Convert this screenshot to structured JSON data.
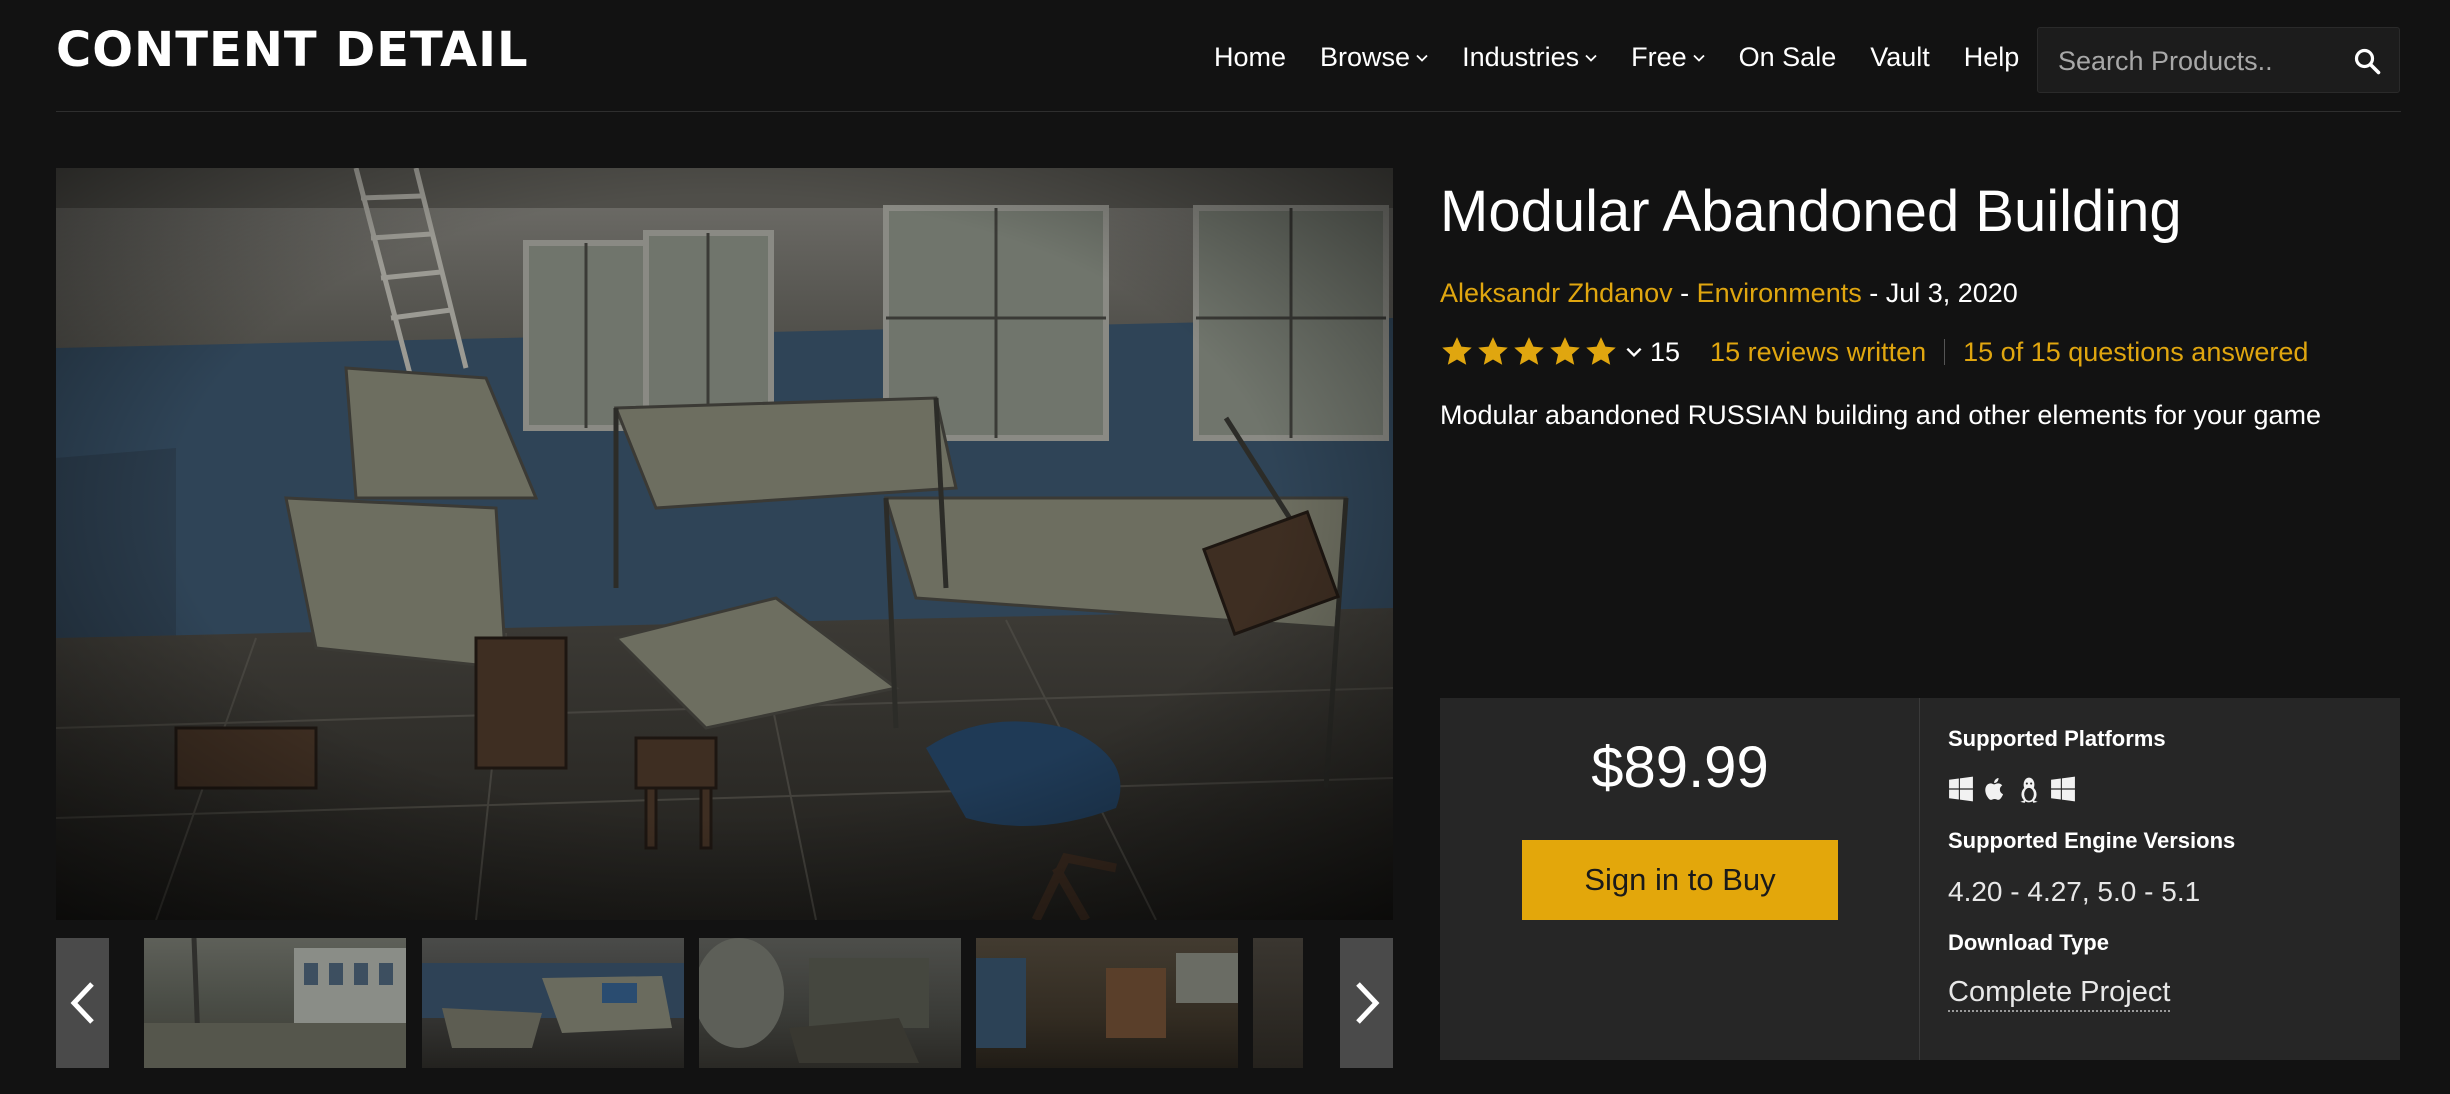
{
  "header": {
    "site_title": "CONTENT DETAIL",
    "nav": [
      {
        "label": "Home",
        "has_dropdown": false
      },
      {
        "label": "Browse",
        "has_dropdown": true
      },
      {
        "label": "Industries",
        "has_dropdown": true
      },
      {
        "label": "Free",
        "has_dropdown": true
      },
      {
        "label": "On Sale",
        "has_dropdown": false
      },
      {
        "label": "Vault",
        "has_dropdown": false
      },
      {
        "label": "Help",
        "has_dropdown": false
      }
    ],
    "search": {
      "placeholder": "Search Products..",
      "icon": "search-icon"
    }
  },
  "product": {
    "title": "Modular Abandoned Building",
    "author": "Aleksandr Zhdanov",
    "category": "Environments",
    "date": "Jul 3, 2020",
    "meta_separator": " - ",
    "rating": {
      "stars": 5,
      "max_stars": 5,
      "count": "15"
    },
    "reviews_link": "15 reviews written",
    "questions_link": "15 of 15 questions answered",
    "description": "Modular abandoned RUSSIAN building and other elements for your game"
  },
  "purchase": {
    "price": "$89.99",
    "buy_button": "Sign in to Buy",
    "platforms_label": "Supported Platforms",
    "platforms": [
      "windows-icon",
      "apple-icon",
      "linux-icon",
      "windows-icon"
    ],
    "engine_label": "Supported Engine Versions",
    "engine_versions": "4.20 - 4.27, 5.0 - 5.1",
    "download_label": "Download Type",
    "download_type": "Complete Project"
  },
  "gallery": {
    "thumbnails": 5,
    "prev_icon": "chevron-left-icon",
    "next_icon": "chevron-right-icon"
  },
  "colors": {
    "accent": "#e0a60f",
    "button": "#e3a70b",
    "background": "#121212",
    "panel": "#262626"
  }
}
